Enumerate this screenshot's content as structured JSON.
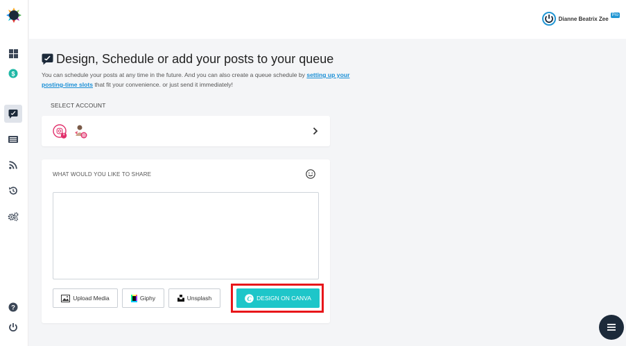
{
  "header": {
    "user_name": "Dianne Beatrix Zee",
    "badge": "Pro"
  },
  "page": {
    "title": "Design, Schedule or add your posts to your queue",
    "intro_before": "You can schedule your posts at any time in the future. And you can also create a queue schedule by ",
    "intro_link": "setting up your posting-time slots",
    "intro_after": " that fit your convenience. or just send it immediately!"
  },
  "accounts": {
    "label": "SELECT ACCOUNT",
    "items": [
      {
        "icon": "instagram-account-icon",
        "badge_count": "1"
      },
      {
        "icon": "instagram-profile-avatar"
      }
    ]
  },
  "composer": {
    "label": "WHAT WOULD YOU LIKE TO SHARE",
    "placeholder": "",
    "buttons": {
      "upload": "Upload Media",
      "giphy": "Giphy",
      "unsplash": "Unsplash",
      "canva": "DESIGN ON CANVA"
    }
  },
  "sidebar": {
    "items": [
      "logo",
      "dashboard",
      "billing",
      "compose",
      "queue",
      "feeds",
      "history",
      "settings",
      "help",
      "logout"
    ]
  },
  "colors": {
    "accent": "#1ec6c9",
    "link": "#1a8fd6",
    "highlight": "#e8161a",
    "badge": "#2196d3",
    "instagram": "#e1306c",
    "fab": "#1c2a3a"
  }
}
